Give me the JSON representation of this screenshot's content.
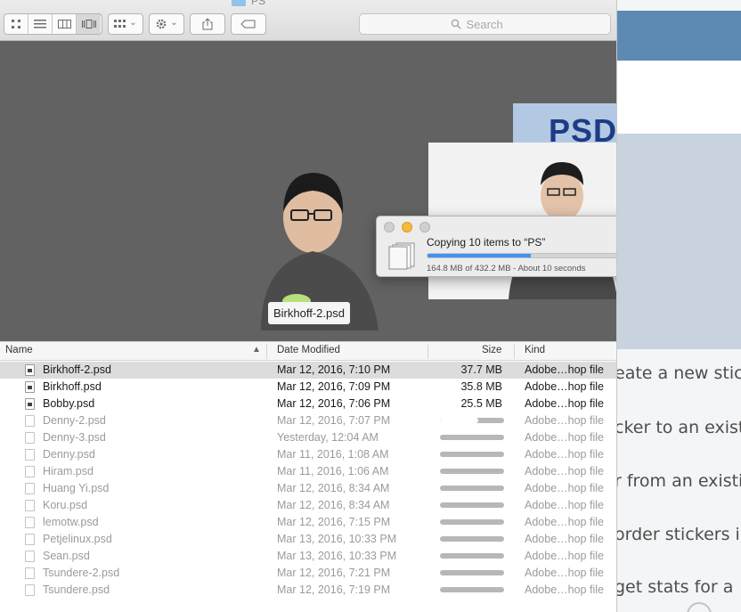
{
  "window": {
    "folder_title": "PS"
  },
  "toolbar": {
    "view_buttons": [
      "icon-view-icon",
      "list-view-icon",
      "column-view-icon",
      "cover-flow-icon"
    ],
    "arrange_chevron": "⌄",
    "action_chevron": "⌄"
  },
  "search": {
    "placeholder": "Search"
  },
  "preview": {
    "caption": "Birkhoff-2.psd",
    "brand_text": "PSD"
  },
  "columns": {
    "name": "Name",
    "date": "Date Modified",
    "size": "Size",
    "kind": "Kind"
  },
  "files": [
    {
      "name": "Birkhoff-2.psd",
      "date": "Mar 12, 2016, 7:10 PM",
      "size": "37.7 MB",
      "kind": "Adobe…hop file",
      "status": "done",
      "selected": true
    },
    {
      "name": "Birkhoff.psd",
      "date": "Mar 12, 2016, 7:09 PM",
      "size": "35.8 MB",
      "kind": "Adobe…hop file",
      "status": "done"
    },
    {
      "name": "Bobby.psd",
      "date": "Mar 12, 2016, 7:06 PM",
      "size": "25.5 MB",
      "kind": "Adobe…hop file",
      "status": "done"
    },
    {
      "name": "Denny-2.psd",
      "date": "Mar 12, 2016, 7:07 PM",
      "kind": "Adobe…hop file",
      "status": "copying",
      "progress": 0.6
    },
    {
      "name": "Denny-3.psd",
      "date": "Yesterday, 12:04 AM",
      "kind": "Adobe…hop file",
      "status": "pending",
      "progress": 0
    },
    {
      "name": "Denny.psd",
      "date": "Mar 11, 2016, 1:08 AM",
      "kind": "Adobe…hop file",
      "status": "pending",
      "progress": 0
    },
    {
      "name": "Hiram.psd",
      "date": "Mar 11, 2016, 1:06 AM",
      "kind": "Adobe…hop file",
      "status": "pending",
      "progress": 0
    },
    {
      "name": "Huang Yi.psd",
      "date": "Mar 12, 2016, 8:34 AM",
      "kind": "Adobe…hop file",
      "status": "pending",
      "progress": 0
    },
    {
      "name": "Koru.psd",
      "date": "Mar 12, 2016, 8:34 AM",
      "kind": "Adobe…hop file",
      "status": "pending",
      "progress": 0
    },
    {
      "name": "lemotw.psd",
      "date": "Mar 12, 2016, 7:15 PM",
      "kind": "Adobe…hop file",
      "status": "pending",
      "progress": 0
    },
    {
      "name": "Petjelinux.psd",
      "date": "Mar 13, 2016, 10:33 PM",
      "kind": "Adobe…hop file",
      "status": "pending",
      "progress": 0
    },
    {
      "name": "Sean.psd",
      "date": "Mar 13, 2016, 10:33 PM",
      "kind": "Adobe…hop file",
      "status": "pending",
      "progress": 0
    },
    {
      "name": "Tsundere-2.psd",
      "date": "Mar 12, 2016, 7:21 PM",
      "kind": "Adobe…hop file",
      "status": "pending",
      "progress": 0
    },
    {
      "name": "Tsundere.psd",
      "date": "Mar 12, 2016, 7:19 PM",
      "kind": "Adobe…hop file",
      "status": "pending",
      "progress": 0
    }
  ],
  "copy_dialog": {
    "title": "Copying 10 items to “PS”",
    "progress": 0.38,
    "status": "164.8 MB of 432.2 MB - About 10 seconds",
    "stop_glyph": "✕"
  },
  "background_page": {
    "lines": [
      "eate a new sticke",
      "cker to an existin",
      "r from an existin",
      "order stickers in",
      "get stats for a"
    ]
  },
  "colors": {
    "accent": "#3d94f6",
    "traffic_yellow": "#f5b93c",
    "header_blue": "#5d8ab3",
    "preview_bg": "#626262"
  }
}
